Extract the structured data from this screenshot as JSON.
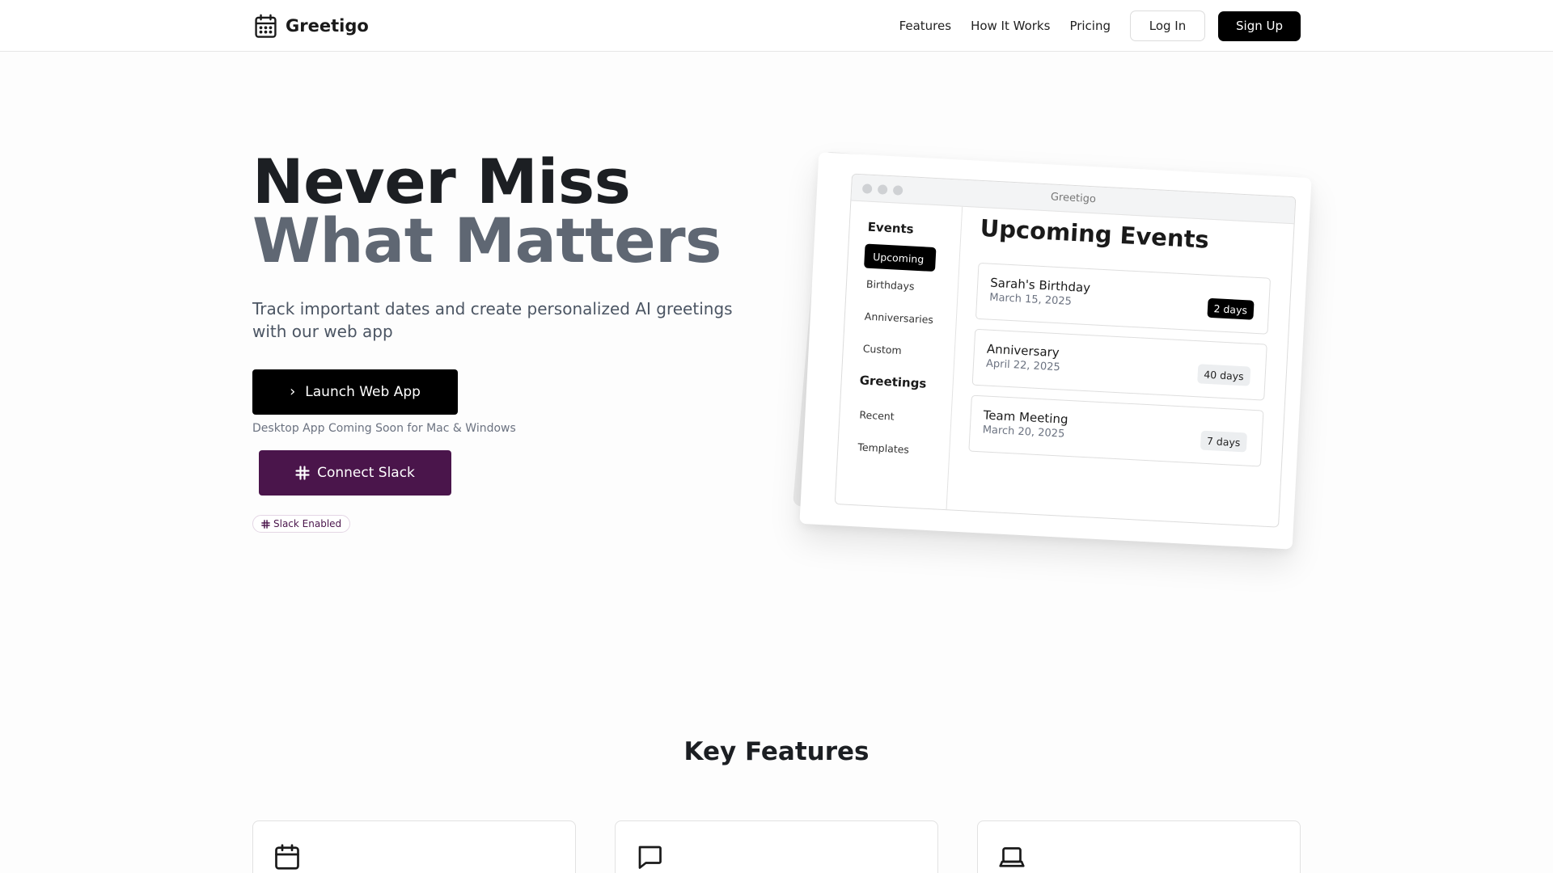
{
  "header": {
    "brand_name": "Greetigo",
    "nav": [
      "Features",
      "How It Works",
      "Pricing"
    ],
    "login_label": "Log In",
    "signup_label": "Sign Up"
  },
  "hero": {
    "title_line1": "Never Miss",
    "title_line2": "What Matters",
    "subtitle": "Track important dates and create personalized AI greetings with our web app",
    "launch_label": "Launch Web App",
    "desktop_note": "Desktop App Coming Soon for Mac & Windows",
    "slack_label": "Connect Slack",
    "slack_badge": "Slack Enabled"
  },
  "mockup": {
    "app_title": "Greetigo",
    "sidebar": {
      "events_heading": "Events",
      "event_items": [
        "Upcoming",
        "Birthdays",
        "Anniversaries",
        "Custom"
      ],
      "greetings_heading": "Greetings",
      "greeting_items": [
        "Recent",
        "Templates"
      ]
    },
    "main_title": "Upcoming Events",
    "events": [
      {
        "name": "Sarah's Birthday",
        "date": "March 15, 2025",
        "badge": "2 days"
      },
      {
        "name": "Anniversary",
        "date": "April 22, 2025",
        "badge": "40 days"
      },
      {
        "name": "Team Meeting",
        "date": "March 20, 2025",
        "badge": "7 days"
      }
    ]
  },
  "features": {
    "title": "Key Features",
    "cards": [
      {
        "icon": "calendar-icon"
      },
      {
        "icon": "chat-icon"
      },
      {
        "icon": "laptop-icon"
      }
    ]
  },
  "colors": {
    "primary": "#000000",
    "slack": "#4a154b",
    "title_muted": "#5f6773"
  }
}
